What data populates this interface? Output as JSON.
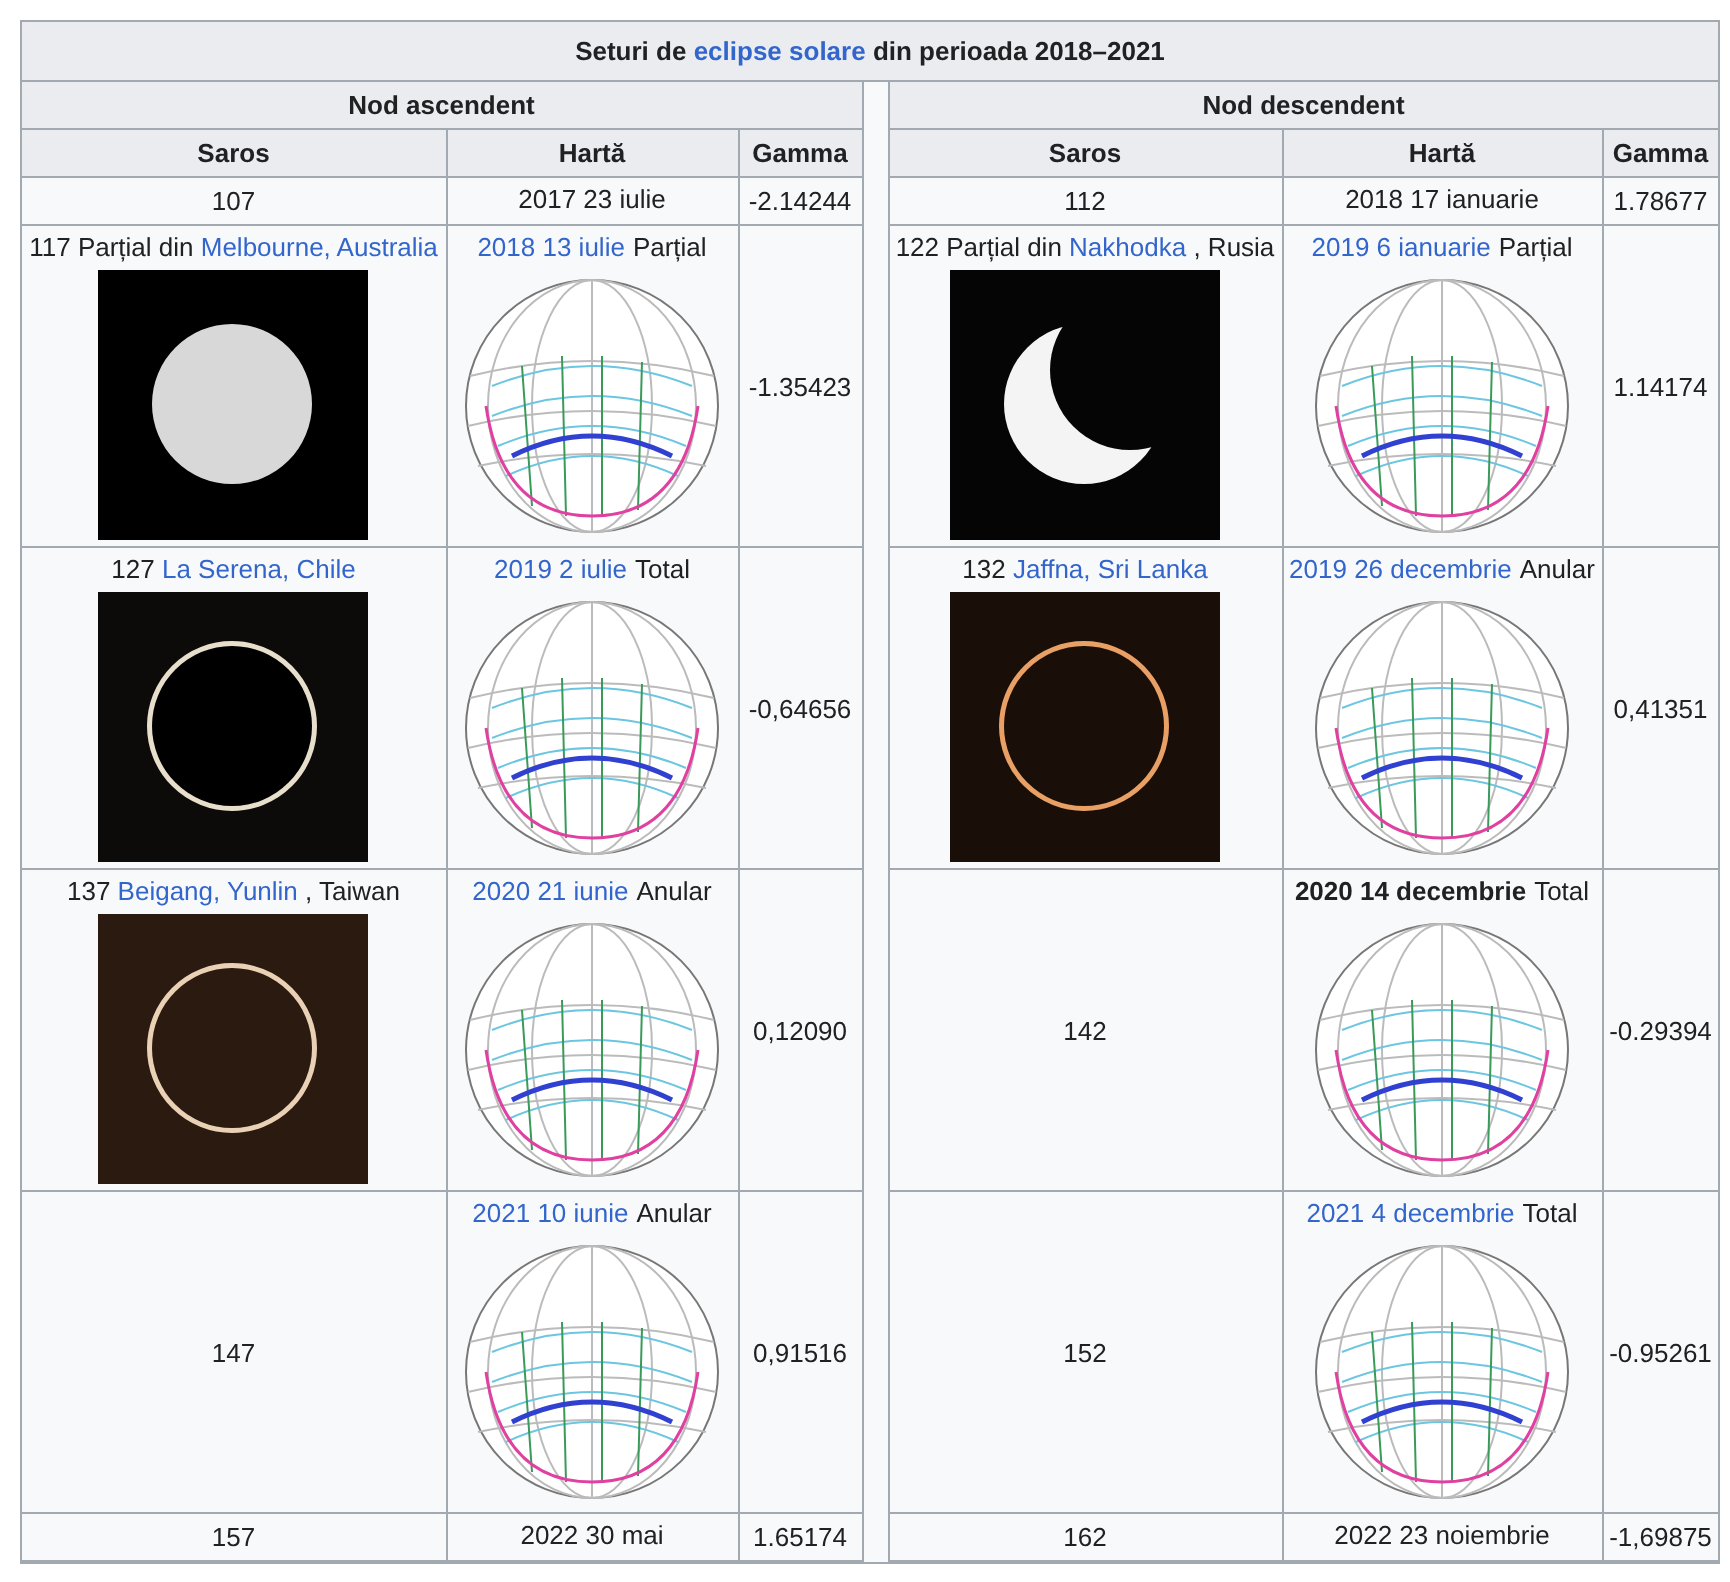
{
  "title": {
    "before": "Seturi de ",
    "link": "eclipse solare",
    "after": " din perioada 2018–2021"
  },
  "nodes": [
    {
      "heading": "Nod ascendent",
      "columns": [
        "Saros",
        "Hartă",
        "Gamma"
      ],
      "rows": [
        {
          "kind": "simple",
          "saros": {
            "text": "107"
          },
          "map": {
            "date": "2017 23 iulie",
            "kind": "plain"
          },
          "gamma": "-2.14244"
        },
        {
          "kind": "image",
          "saros": {
            "text": "117 Parțial din ",
            "link": "Melbourne, Australia"
          },
          "photo": {
            "kind": "partial_grey"
          },
          "map": {
            "date": "2018 13 iulie",
            "kind": "link",
            "type": "Parțial"
          },
          "gamma": "-1.35423"
        },
        {
          "kind": "image",
          "saros": {
            "text": "127 ",
            "link": "La Serena, Chile"
          },
          "photo": {
            "kind": "total"
          },
          "map": {
            "date": "2019 2 iulie",
            "kind": "link",
            "type": "Total"
          },
          "gamma": "-0,64656"
        },
        {
          "kind": "image",
          "saros": {
            "text": "137 ",
            "link": "Beigang, Yunlin",
            "suffix": " , Taiwan"
          },
          "photo": {
            "kind": "annular_dim"
          },
          "map": {
            "date": "2020 21 iunie",
            "kind": "link",
            "type": "Anular"
          },
          "gamma": "0,12090"
        },
        {
          "kind": "image",
          "saros": {
            "text": "147"
          },
          "map": {
            "date": "2021 10 iunie",
            "kind": "link",
            "type": "Anular"
          },
          "gamma": "0,91516"
        },
        {
          "kind": "simple",
          "saros": {
            "text": "157"
          },
          "map": {
            "date": "2022 30 mai",
            "kind": "plain"
          },
          "gamma": "1.65174"
        }
      ]
    },
    {
      "heading": "Nod descendent",
      "columns": [
        "Saros",
        "Hartă",
        "Gamma"
      ],
      "rows": [
        {
          "kind": "simple",
          "saros": {
            "text": "112"
          },
          "map": {
            "date": "2018 17 ianuarie",
            "kind": "plain"
          },
          "gamma": "1.78677"
        },
        {
          "kind": "image",
          "saros": {
            "text": "122 Parțial din ",
            "link": "Nakhodka",
            "suffix": " , Rusia"
          },
          "photo": {
            "kind": "partial_crescent"
          },
          "map": {
            "date": "2019 6 ianuarie",
            "kind": "link",
            "type": "Parțial"
          },
          "gamma": "1.14174"
        },
        {
          "kind": "image",
          "saros": {
            "text": "132 ",
            "link": "Jaffna, Sri Lanka"
          },
          "photo": {
            "kind": "annular"
          },
          "map": {
            "date": "2019 26 decembrie",
            "kind": "link",
            "type": "Anular"
          },
          "gamma": "0,41351"
        },
        {
          "kind": "image",
          "saros": {
            "text": "142"
          },
          "map": {
            "date": "2020 14 decembrie",
            "kind": "bold",
            "type": "Total"
          },
          "gamma": "-0.29394"
        },
        {
          "kind": "image",
          "saros": {
            "text": "152"
          },
          "map": {
            "date": "2021 4 decembrie",
            "kind": "link",
            "type": "Total"
          },
          "gamma": "-0.95261"
        },
        {
          "kind": "simple",
          "saros": {
            "text": "162"
          },
          "map": {
            "date": "2022 23 noiembrie",
            "kind": "plain"
          },
          "gamma": "-1,69875"
        }
      ]
    }
  ]
}
